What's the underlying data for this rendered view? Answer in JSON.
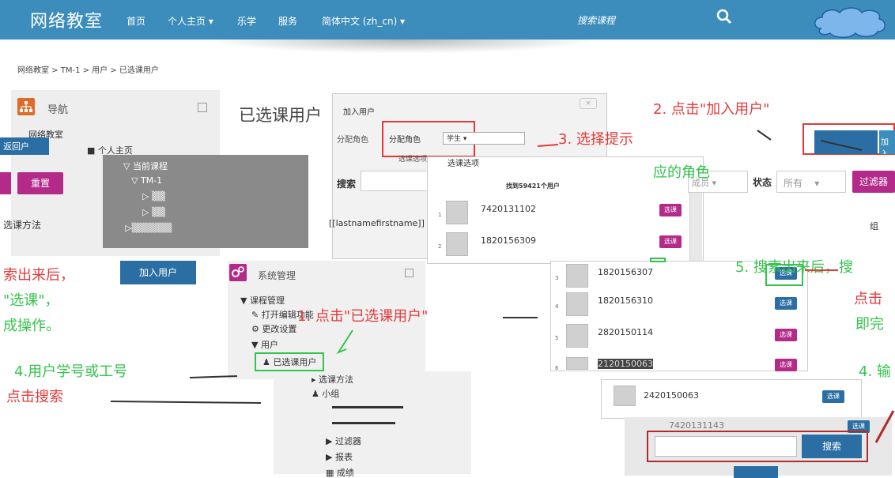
{
  "topbar": {
    "brand": "网络教室",
    "nav": [
      "首页",
      "个人主页 ▾",
      "乐学",
      "服务",
      "简体中文 (zh_cn) ▾"
    ],
    "search_placeholder": "搜索课程"
  },
  "breadcrumb": "网络教室 > TM-1 > 用户 > 已选课用户",
  "left": {
    "nav_title": "导航",
    "nav_root": "网络教室",
    "personal": "个人主页",
    "left_tab": "返回户",
    "reset": "重置",
    "method": "选课方法",
    "add_user": "加入用户"
  },
  "page_title": "已选课用户",
  "modal": {
    "title": "加入用户",
    "close": "×",
    "role_label": "分配角色",
    "role_value": "学生",
    "search_label": "搜索",
    "column": "[[lastnamefirstname]] /",
    "options_header": "选课选项",
    "found": "找到59421个用户"
  },
  "users": [
    {
      "n": "1",
      "id": "7420131102",
      "btn": "选课"
    },
    {
      "n": "2",
      "id": "1820156309",
      "btn": "选课"
    },
    {
      "n": "3",
      "id": "1820156307",
      "btn": "选课"
    },
    {
      "n": "4",
      "id": "1820156310",
      "btn": "选课"
    },
    {
      "n": "5",
      "id": "2820150114",
      "btn": "选课"
    },
    {
      "n": "6",
      "id": "2120150063",
      "btn": "选课"
    },
    {
      "n": "",
      "id": "2420150063",
      "btn": "选课"
    },
    {
      "n": "",
      "id": "7420131143",
      "btn": "选课"
    }
  ],
  "filters": {
    "role": "成员",
    "status_label": "状态",
    "status_value": "所有",
    "filter_btn": "过滤器",
    "group": "组"
  },
  "admin": {
    "title": "系统管理",
    "course_admin": "课程管理",
    "edit_on": "打开编辑功能",
    "settings": "更改设置",
    "users": "用户",
    "selected_users": "已选课用户",
    "method": "选课方法",
    "groups": "小组",
    "filters": "过滤器",
    "reports": "报表",
    "grades": "成绩"
  },
  "search_btn": "搜索",
  "annotations": {
    "a1": "1. 点击\"已选课用户\"",
    "a2": "2. 点击\"加入用户\"",
    "a3_1": "3. 选择提示",
    "a3_2": "应的角色",
    "a4": "4. 输",
    "a5_1": "5. 搜索出来后，搜",
    "a5_2": "点击",
    "a5_3": "即完",
    "l1": "索出来后，",
    "l2": "\"选课\"，",
    "l3": "成操作。",
    "l4": "4.用户学号或工号",
    "l5": "点击搜索"
  },
  "colors": {
    "blue": "#3c8dbc",
    "magenta": "#b32a88",
    "red": "#e23a3a",
    "green": "#34c34c"
  }
}
